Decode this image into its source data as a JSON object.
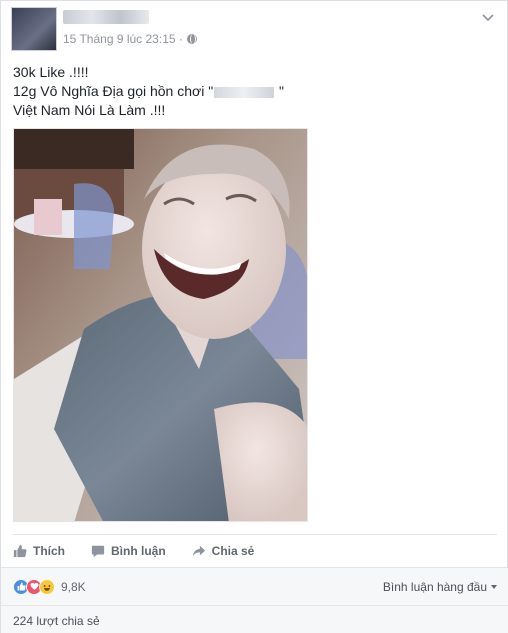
{
  "post": {
    "timestamp": "15 Tháng 9 lúc 23:15 ·",
    "lines": [
      "30k Like .!!!!",
      "12g Vô Nghĩa Địa gọi hồn chơi \"",
      "Việt Nam Nói Là Làm .!!!"
    ],
    "line2_tail": " \""
  },
  "actions": {
    "like_label": "Thích",
    "comment_label": "Bình luận",
    "share_label": "Chia sẻ"
  },
  "reactions": {
    "count": "9,8K",
    "sort_label": "Bình luận hàng đầu"
  },
  "shares": {
    "label": "224 lượt chia sẻ"
  },
  "icons": {
    "like": "like-icon",
    "comment": "comment-icon",
    "share": "share-icon",
    "globe": "globe-icon",
    "chevron": "chevron-down-icon"
  },
  "colors": {
    "like": "#4a90e2",
    "love": "#f25268",
    "haha": "#f7c83e"
  }
}
